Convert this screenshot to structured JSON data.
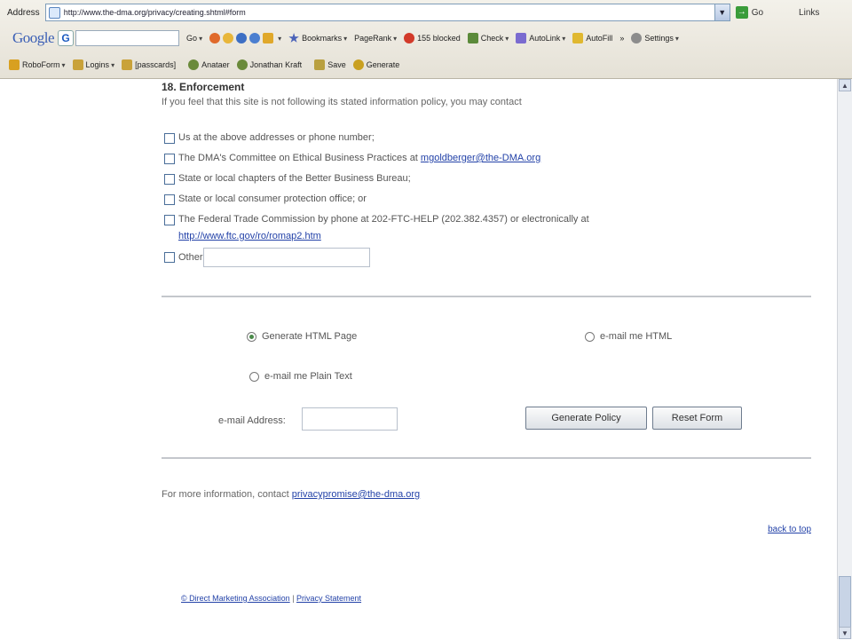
{
  "browser": {
    "address_label": "Address",
    "url": "http://www.the-dma.org/privacy/creating.shtml#form",
    "go_label": "Go",
    "links_label": "Links",
    "google_logo": "Google",
    "google_g": "G",
    "toolbar": {
      "go": "Go",
      "bookmarks": "Bookmarks",
      "pagerank": "PageRank",
      "blocked": "155 blocked",
      "check": "Check",
      "autolink": "AutoLink",
      "autofill": "AutoFill",
      "more": "»",
      "settings": "Settings"
    },
    "links_bar": [
      {
        "label": "RoboForm",
        "icon": "roboform-icon",
        "caret": true
      },
      {
        "label": "Logins",
        "icon": "logins-icon",
        "caret": true
      },
      {
        "label": "[passcards]",
        "icon": "passcards-icon",
        "caret": false
      },
      {
        "label": "Anataer",
        "icon": "identity-icon",
        "caret": false
      },
      {
        "label": "Jonathan Kraft",
        "icon": "identity-icon",
        "caret": false
      },
      {
        "label": "Save",
        "icon": "save-icon",
        "caret": false
      },
      {
        "label": "Generate",
        "icon": "generate-icon",
        "caret": false
      }
    ]
  },
  "page": {
    "heading": "18. Enforcement",
    "intro": "If you feel that this site is not following its stated information policy, you may contact",
    "options": {
      "opt1": "Us at the above addresses or phone number;",
      "opt2_text": "The DMA's Committee on Ethical Business Practices at ",
      "opt2_link": "mgoldberger@the-DMA.org",
      "opt3": "State or local chapters of the Better Business Bureau;",
      "opt4": "State or local consumer protection office; or",
      "opt5_text": "The Federal Trade Commission by phone at 202-FTC-HELP (202.382.4357) or electronically at",
      "opt5_link": "http://www.ftc.gov/ro/romap2.htm",
      "other_label": "Other"
    },
    "output": {
      "generate_html": "Generate HTML Page",
      "email_html": "e-mail me HTML",
      "email_plain": "e-mail me Plain Text",
      "email_label": "e-mail Address:",
      "generate_button": "Generate Policy",
      "reset_button": "Reset Form"
    },
    "more_info_text": "For more information, contact ",
    "more_info_link": "privacypromise@the-dma.org",
    "back_to_top": "back to top",
    "footer_org": "© Direct Marketing Association",
    "footer_sep": " | ",
    "footer_privacy": "Privacy Statement"
  },
  "colors": {
    "link": "#2342a8",
    "chrome_bg": "#e5e1d6",
    "rule": "#c4c7cc",
    "selected_radio": "#4a8a4a"
  }
}
